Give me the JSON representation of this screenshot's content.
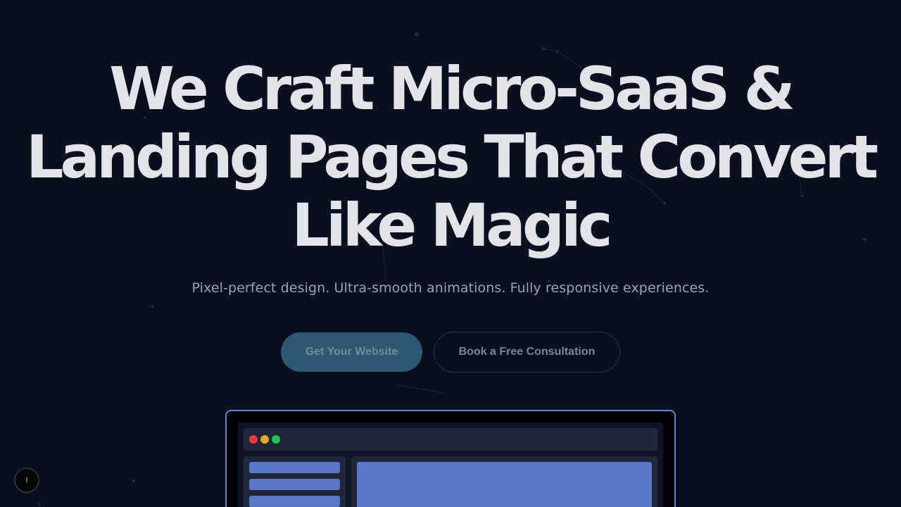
{
  "hero": {
    "title_line1": "We Craft Micro-SaaS &",
    "title_line2": "Landing Pages That Convert",
    "title_line3": "Like Magic",
    "subtitle": "Pixel-perfect design. Ultra-smooth animations. Fully responsive experiences."
  },
  "cta": {
    "primary_label": "Get Your Website",
    "secondary_label": "Book a Free Consultation"
  },
  "floating_button": {
    "label": "I"
  },
  "colors": {
    "background": "#0a0f1e",
    "title": "#e2e4e9",
    "subtitle": "#8ea6b9",
    "primary_button": "#2d5871",
    "device_border": "#6b7fd0",
    "mockup_accent": "#5b79c9",
    "window_red": "#ef3340",
    "window_yellow": "#f0a70f",
    "window_green": "#20c45a"
  }
}
